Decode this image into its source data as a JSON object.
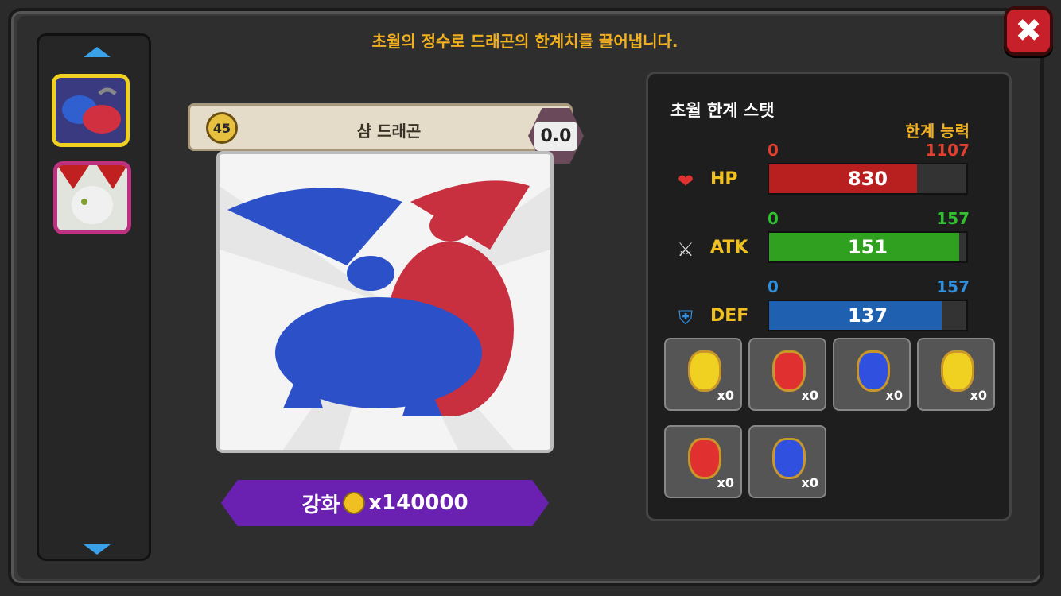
{
  "header": {
    "subtitle": "초월의 정수로 드래곤의 한계치를 끌어냅니다."
  },
  "unit": {
    "level": "45",
    "name": "샴 드래곤",
    "rank": "0.0"
  },
  "enhance": {
    "label": "강화",
    "cost": "x140000"
  },
  "stats_panel": {
    "title": "초월 한계 스탯",
    "limit_label": "한계 능력",
    "stats": [
      {
        "name": "HP",
        "min": "0",
        "max": "1107",
        "value": "830",
        "fill": 0.75,
        "color": "#b82020",
        "label_color": "#e04030"
      },
      {
        "name": "ATK",
        "min": "0",
        "max": "157",
        "value": "151",
        "fill": 0.962,
        "color": "#30a020",
        "label_color": "#30c030"
      },
      {
        "name": "DEF",
        "min": "0",
        "max": "157",
        "value": "137",
        "fill": 0.873,
        "color": "#2060b0",
        "label_color": "#3090e0"
      }
    ]
  },
  "items": [
    {
      "qty": "x0",
      "color": "#f0d020"
    },
    {
      "qty": "x0",
      "color": "#e03030"
    },
    {
      "qty": "x0",
      "color": "#3050e0"
    },
    {
      "qty": "x0",
      "color": "#f0d020"
    },
    {
      "qty": "x0",
      "color": "#e03030"
    },
    {
      "qty": "x0",
      "color": "#3050e0"
    }
  ]
}
